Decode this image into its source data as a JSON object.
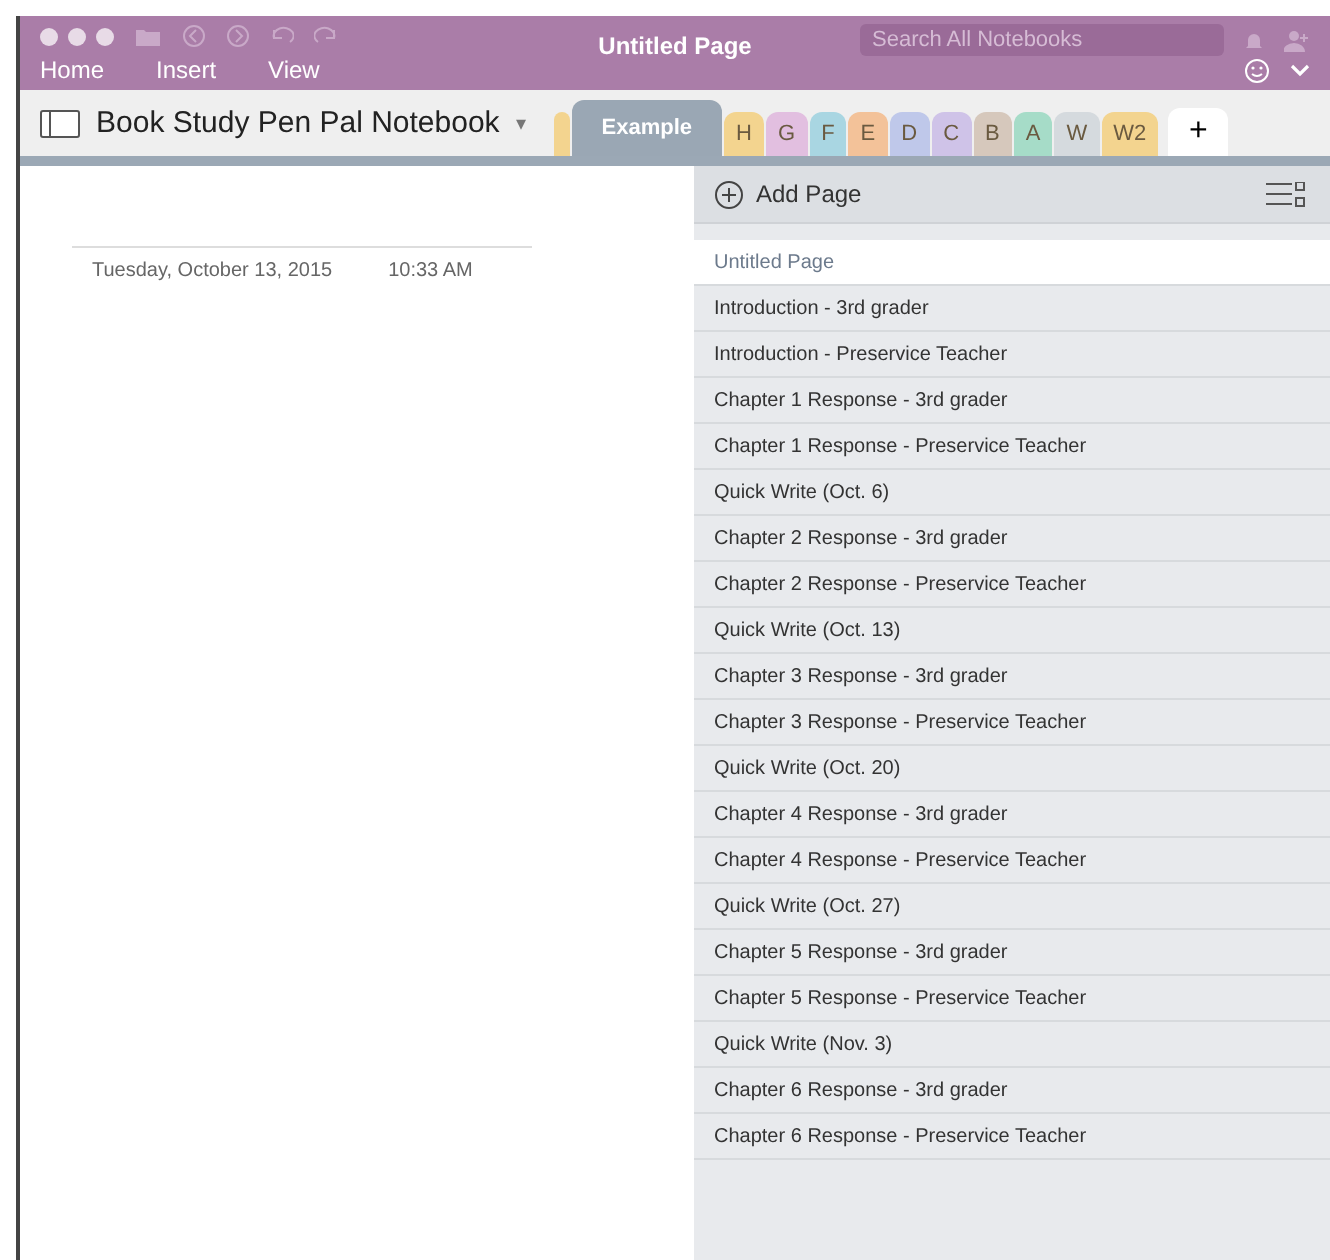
{
  "window": {
    "title": "Untitled Page"
  },
  "search": {
    "placeholder": "Search All Notebooks"
  },
  "menu": [
    "Home",
    "Insert",
    "View"
  ],
  "notebook": {
    "name": "Book Study Pen Pal Notebook",
    "caret": "▾"
  },
  "sections": [
    {
      "label": "Example",
      "selected": true,
      "color": "#9aa7b4"
    },
    {
      "label": "H",
      "selected": false,
      "color": "#f3d48f"
    },
    {
      "label": "G",
      "selected": false,
      "color": "#e2bfe0"
    },
    {
      "label": "F",
      "selected": false,
      "color": "#a9d6e2"
    },
    {
      "label": "E",
      "selected": false,
      "color": "#f3c299"
    },
    {
      "label": "D",
      "selected": false,
      "color": "#bfc8ea"
    },
    {
      "label": "C",
      "selected": false,
      "color": "#cfc3e8"
    },
    {
      "label": "B",
      "selected": false,
      "color": "#d6c8bc"
    },
    {
      "label": "A",
      "selected": false,
      "color": "#a6dcc8"
    },
    {
      "label": "W",
      "selected": false,
      "color": "#d5dade"
    },
    {
      "label": "W2",
      "selected": false,
      "color": "#f3d48f"
    }
  ],
  "add_section": "+",
  "page": {
    "date": "Tuesday, October 13, 2015",
    "time": "10:33 AM"
  },
  "add_page": "Add Page",
  "pages": [
    {
      "title": "Untitled Page",
      "selected": true
    },
    {
      "title": "Introduction - 3rd grader",
      "selected": false
    },
    {
      "title": "Introduction - Preservice Teacher",
      "selected": false
    },
    {
      "title": "Chapter 1 Response - 3rd grader",
      "selected": false
    },
    {
      "title": "Chapter 1 Response - Preservice Teacher",
      "selected": false
    },
    {
      "title": "Quick Write (Oct. 6)",
      "selected": false
    },
    {
      "title": "Chapter 2 Response - 3rd grader",
      "selected": false
    },
    {
      "title": "Chapter 2 Response - Preservice Teacher",
      "selected": false
    },
    {
      "title": "Quick Write (Oct. 13)",
      "selected": false
    },
    {
      "title": "Chapter 3 Response - 3rd grader",
      "selected": false
    },
    {
      "title": "Chapter 3 Response - Preservice Teacher",
      "selected": false
    },
    {
      "title": "Quick Write (Oct. 20)",
      "selected": false
    },
    {
      "title": "Chapter 4 Response - 3rd grader",
      "selected": false
    },
    {
      "title": "Chapter 4 Response - Preservice Teacher",
      "selected": false
    },
    {
      "title": "Quick Write (Oct. 27)",
      "selected": false
    },
    {
      "title": "Chapter 5 Response - 3rd grader",
      "selected": false
    },
    {
      "title": "Chapter 5 Response - Preservice Teacher",
      "selected": false
    },
    {
      "title": "Quick Write (Nov. 3)",
      "selected": false
    },
    {
      "title": "Chapter 6 Response - 3rd grader",
      "selected": false
    },
    {
      "title": "Chapter 6 Response - Preservice Teacher",
      "selected": false
    }
  ]
}
